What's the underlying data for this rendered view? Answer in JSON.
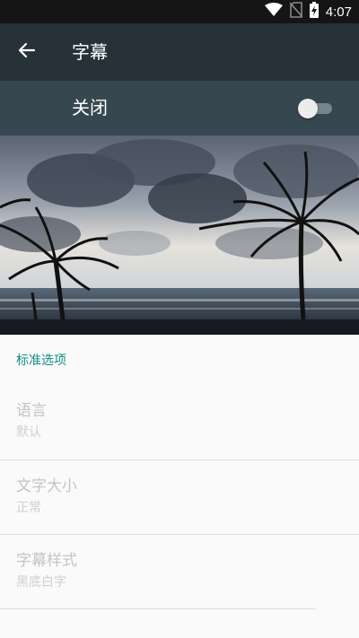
{
  "status_bar": {
    "time": "4:07",
    "icons": [
      "wifi-icon",
      "no-sim-icon",
      "battery-charging-icon"
    ]
  },
  "app_bar": {
    "title": "字幕",
    "back_icon": "arrow-back-icon"
  },
  "master_switch": {
    "label": "关闭",
    "checked": false
  },
  "preview": {
    "description_icon": "caption-preview-image"
  },
  "section": {
    "header": "标准选项",
    "items": [
      {
        "title": "语言",
        "summary": "默认"
      },
      {
        "title": "文字大小",
        "summary": "正常"
      },
      {
        "title": "字幕样式",
        "summary": "黑底白字"
      }
    ]
  },
  "colors": {
    "status_bar": "#151515",
    "app_bar": "#263238",
    "switch_bar": "#37474f",
    "accent": "#138c85",
    "disabled_text": "#c4c4c4"
  }
}
